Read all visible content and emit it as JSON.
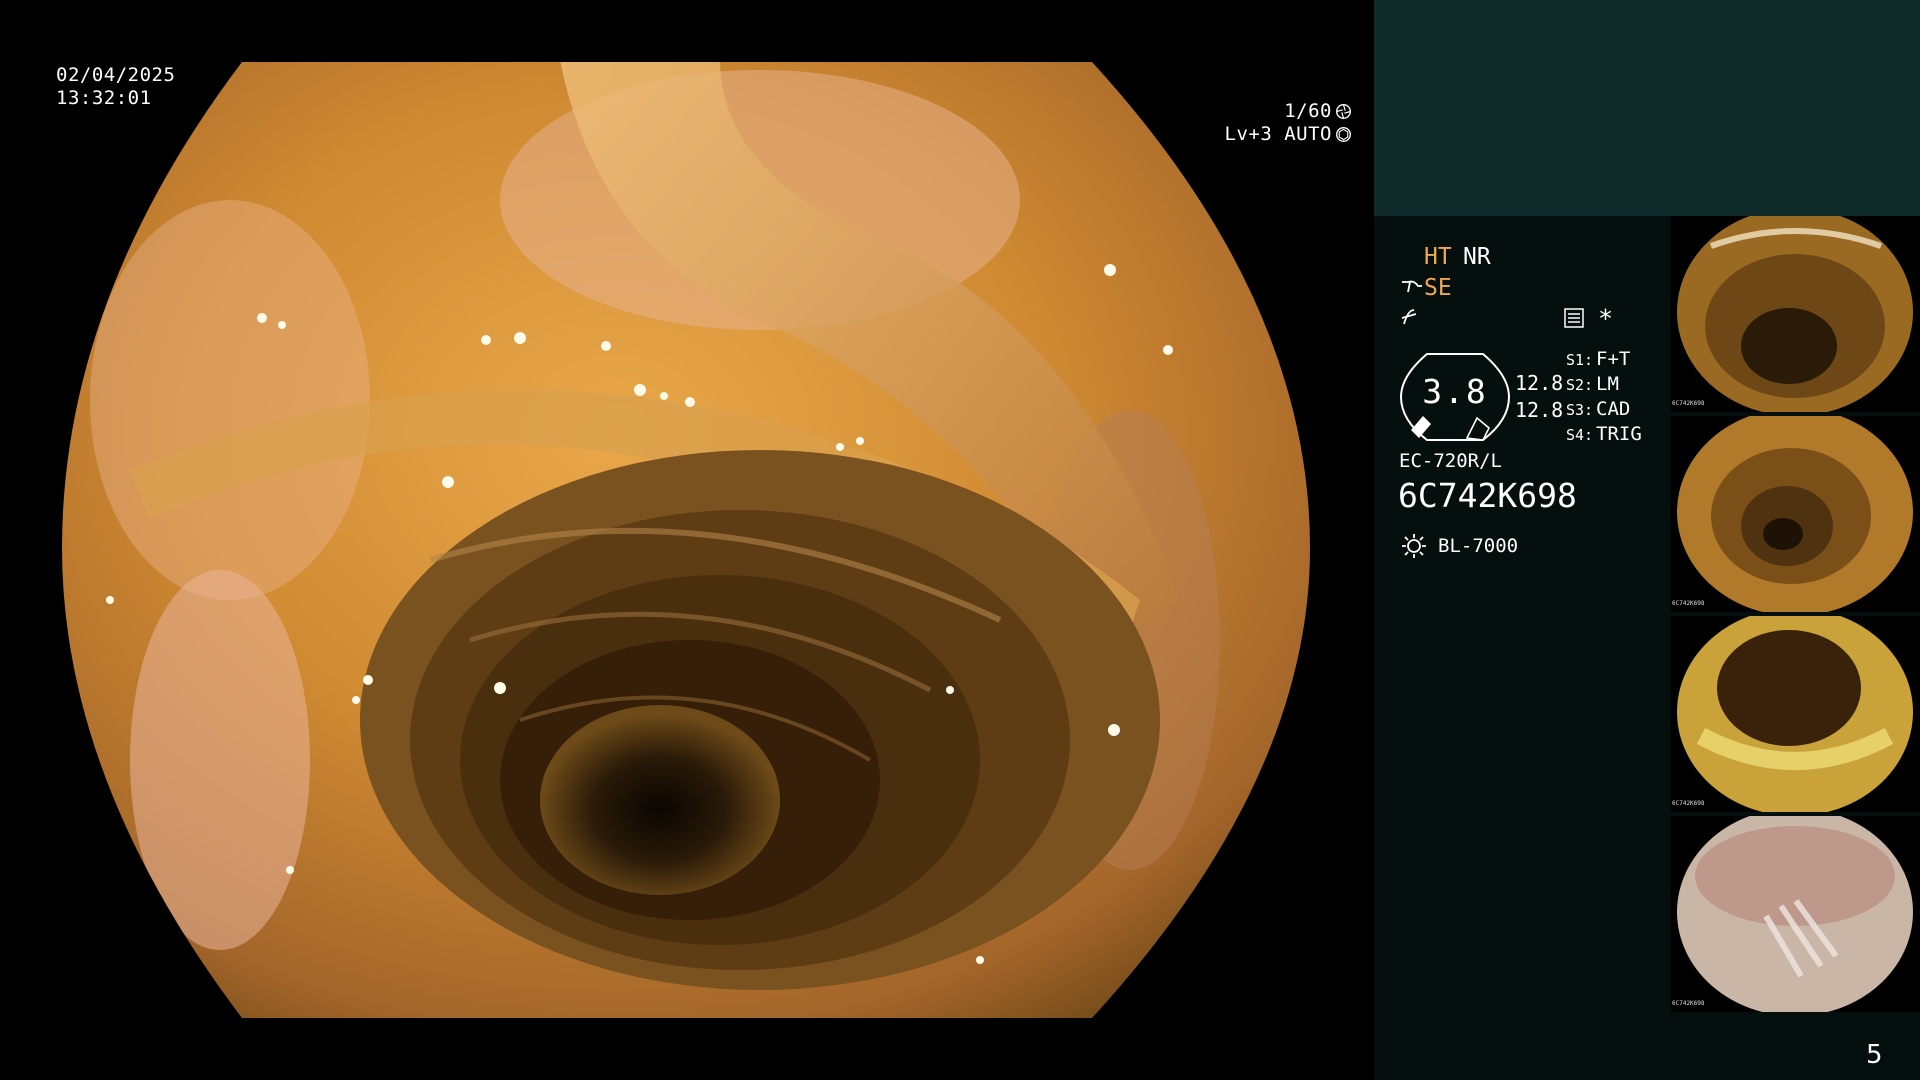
{
  "overlay": {
    "date": "02/04/2025",
    "time": "13:32:01",
    "shutter": "1/60",
    "iris": "Lv+3 AUTO"
  },
  "modes": {
    "ht": "HT",
    "nr": "NR",
    "se": "SE",
    "star": "*"
  },
  "gauge": {
    "value": "3.8",
    "v1": "12.8",
    "v2": "12.8"
  },
  "switches": [
    {
      "key": "S1:",
      "value": "F+T"
    },
    {
      "key": "S2:",
      "value": "LM"
    },
    {
      "key": "S3:",
      "value": "CAD"
    },
    {
      "key": "S4:",
      "value": "TRIG"
    }
  ],
  "scope": {
    "model": "EC-720R/L",
    "serial": "6C742K698"
  },
  "light": {
    "model": "BL-7000"
  },
  "thumbnails": [
    {
      "caption": "6C742K698"
    },
    {
      "caption": "6C742K698"
    },
    {
      "caption": "6C742K698"
    },
    {
      "caption": "6C742K698"
    }
  ],
  "page_number": "5",
  "colors": {
    "panel_top": "#0e2b2a",
    "panel": "#050f0e",
    "accent": "#f0a850"
  },
  "icons": [
    "shutter-icon",
    "iris-icon",
    "se-icon",
    "f-icon",
    "document-icon",
    "sun-icon"
  ]
}
